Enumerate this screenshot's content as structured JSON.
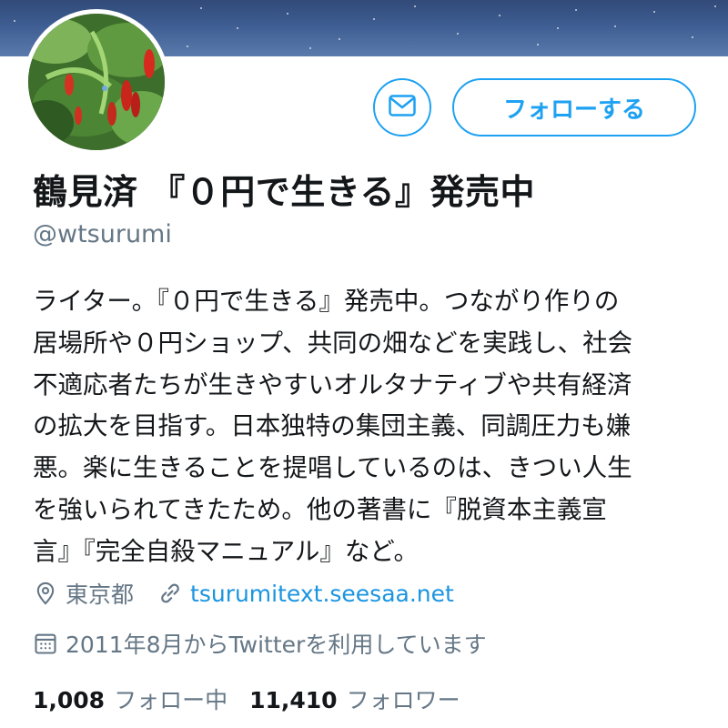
{
  "profile": {
    "name": "鶴見済 『０円で生きる』発売中",
    "handle": "@wtsurumi",
    "bio": "ライター。『０円で生きる』発売中。つながり作りの\n居場所や０円ショップ、共同の畑などを実践し、社会\n不適応者たちが生きやすいオルタナティブや共有経済\nの拡大を目指す。日本独特の集団主義、同調圧力も嫌\n悪。楽に生きることを提唱しているのは、きつい人生\nを強いられてきたため。他の著書に『脱資本主義宣\n言』『完全自殺マニュアル』など。",
    "location": "東京都",
    "url": "tsurumitext.seesaa.net",
    "joined": "2011年8月からTwitterを利用しています"
  },
  "actions": {
    "message_icon": "envelope-icon",
    "follow_label": "フォローする"
  },
  "stats": {
    "following_count": "1,008",
    "following_label": "フォロー中",
    "followers_count": "11,410",
    "followers_label": "フォロワー"
  },
  "icons": {
    "location": "location-pin-icon",
    "link": "link-icon",
    "calendar": "calendar-icon"
  },
  "colors": {
    "accent": "#1da1f2",
    "link": "#1b95e0",
    "text": "#14171a",
    "muted": "#657786"
  }
}
